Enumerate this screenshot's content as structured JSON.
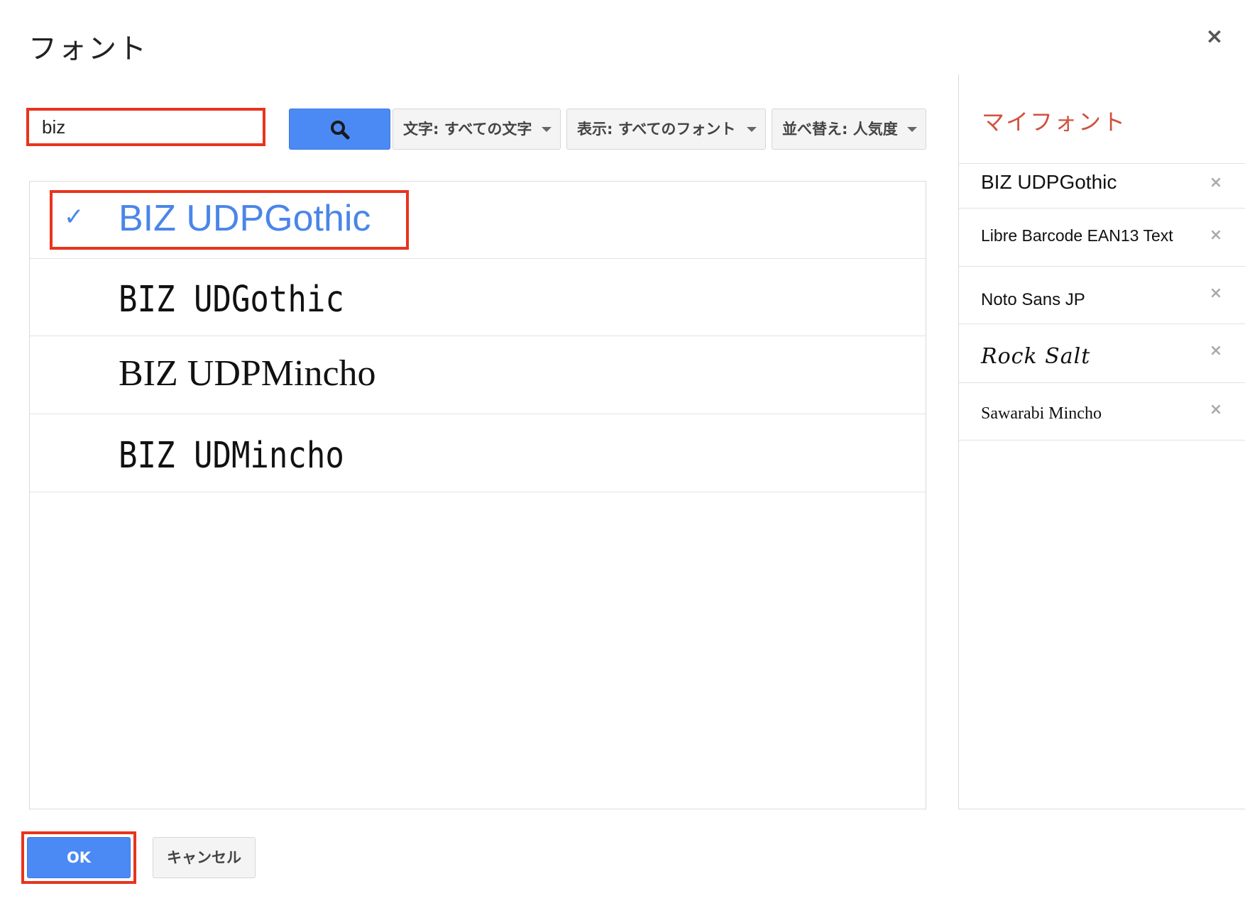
{
  "dialog": {
    "title": "フォント",
    "close_label": "×"
  },
  "toolbar": {
    "search": {
      "value": "biz",
      "placeholder": ""
    },
    "search_icon": "search-icon",
    "filters": {
      "characters": "文字: すべての文字",
      "show": "表示: すべてのフォント",
      "sort": "並べ替え: 人気度"
    }
  },
  "font_list": {
    "items": [
      {
        "name": "BIZ UDPGothic",
        "selected": true,
        "check": "✓"
      },
      {
        "name": "BIZ UDGothic",
        "selected": false
      },
      {
        "name": "BIZ UDPMincho",
        "selected": false
      },
      {
        "name": "BIZ UDMincho",
        "selected": false
      }
    ]
  },
  "my_fonts": {
    "title": "マイフォント",
    "remove_label": "×",
    "items": [
      {
        "name": "BIZ UDPGothic"
      },
      {
        "name": "Libre Barcode EAN13 Text"
      },
      {
        "name": "Noto Sans JP"
      },
      {
        "name": "Rock Salt"
      },
      {
        "name": "Sawarabi Mincho"
      }
    ]
  },
  "footer": {
    "ok_label": "OK",
    "cancel_label": "キャンセル"
  },
  "colors": {
    "accent": "#4b8af5",
    "highlight_box": "#e8341d",
    "my_fonts_title": "#d1513f"
  }
}
